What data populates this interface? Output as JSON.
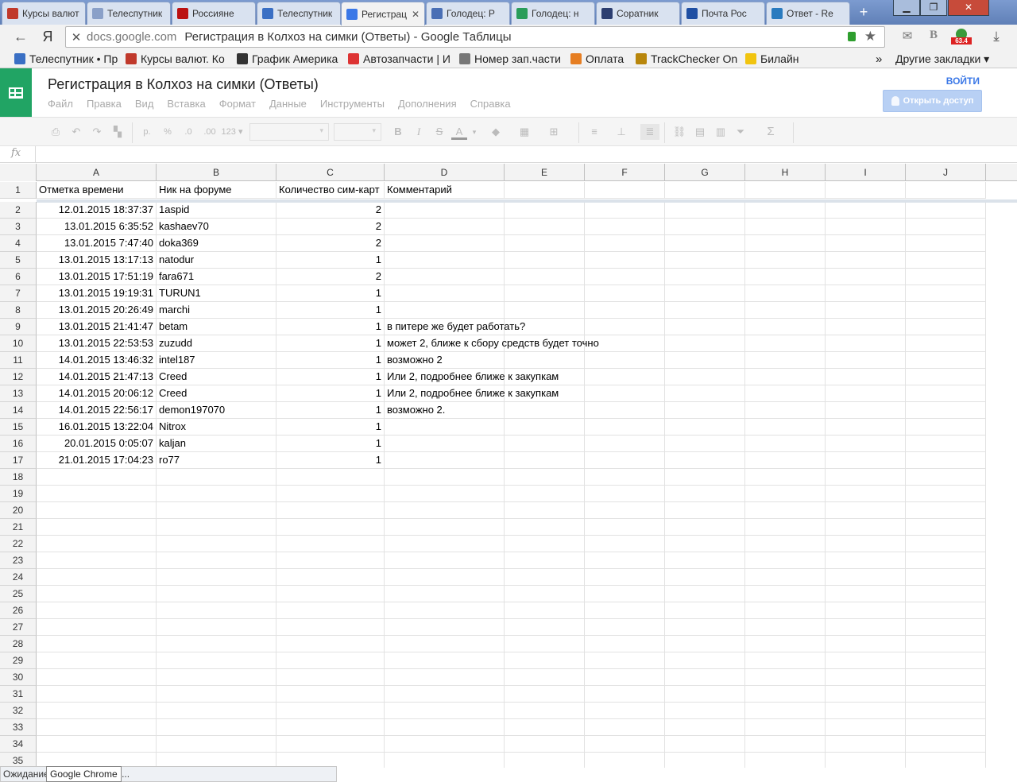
{
  "browser": {
    "tabs": [
      {
        "title": "Курсы валют",
        "color": "#c0392b",
        "icon": "bank-icon"
      },
      {
        "title": "Телеспутник",
        "color": "#8aa0c8",
        "icon": "loading-icon"
      },
      {
        "title": "Россияне",
        "color": "#b11",
        "icon": "v-icon"
      },
      {
        "title": "Телеспутник",
        "color": "#3a6fc4",
        "icon": "satellite-icon"
      },
      {
        "title": "Регистрация",
        "color": "#3b78e7",
        "icon": "loading-icon"
      },
      {
        "title": "Голодец: Р",
        "color": "#4a6fb5",
        "icon": "doc-icon"
      },
      {
        "title": "Голодец: н",
        "color": "#2a9d5a",
        "icon": "globe-icon"
      },
      {
        "title": "Соратник",
        "color": "#2c3e70",
        "icon": "moon-icon"
      },
      {
        "title": "Почта Рос",
        "color": "#1f4fa3",
        "icon": "eagle-icon"
      },
      {
        "title": "Ответ - Re",
        "color": "#2a7bbf",
        "icon": "chrome-icon"
      }
    ],
    "active_tab": 4,
    "new_tab": "+",
    "url_host": "docs.google.com",
    "url_title": "Регистрация в Колхоз на симки (Ответы) - Google Таблицы",
    "back": "←",
    "yandex": "Я",
    "stop": "✕",
    "star": "★",
    "download": "⤓",
    "badge": "63.4",
    "bookmarks": [
      {
        "label": "Телеспутник • Пр",
        "color": "#3a6fc4"
      },
      {
        "label": "Курсы валют. Ко",
        "color": "#c0392b"
      },
      {
        "label": "График Америка",
        "color": "#333"
      },
      {
        "label": "Автозапчасти | И",
        "color": "#d33"
      },
      {
        "label": "Номер зап.части",
        "color": "#777"
      },
      {
        "label": "Оплата",
        "color": "#e67e22"
      },
      {
        "label": "TrackChecker On",
        "color": "#b8860b"
      },
      {
        "label": "Билайн",
        "color": "#f1c40f"
      }
    ],
    "bookmarks_more": "»",
    "other_bookmarks": "Другие закладки ▾"
  },
  "docs": {
    "title": "Регистрация в Колхоз на симки (Ответы)",
    "menu": [
      "Файл",
      "Правка",
      "Вид",
      "Вставка",
      "Формат",
      "Данные",
      "Инструменты",
      "Дополнения",
      "Справка"
    ],
    "signin": "ВОЙТИ",
    "share": "Открыть доступ",
    "toolbar": {
      "currency": "р.",
      "percent": "%",
      "dec_less": ".0",
      "dec_more": ".00",
      "format": "123 ▾",
      "bold": "B",
      "italic": "I",
      "strike": "S",
      "textcolor": "A",
      "sigma": "Σ"
    },
    "fx": "fx"
  },
  "sheet": {
    "columns": [
      "A",
      "B",
      "C",
      "D",
      "E",
      "F",
      "G",
      "H",
      "I",
      "J"
    ],
    "header_row": [
      "Отметка времени",
      "Ник на форуме",
      "Количество сим-карт",
      "Комментарий"
    ],
    "rows": [
      [
        "12.01.2015 18:37:37",
        "1aspid",
        "2",
        ""
      ],
      [
        "13.01.2015 6:35:52",
        "kashaev70",
        "2",
        ""
      ],
      [
        "13.01.2015 7:47:40",
        "doka369",
        "2",
        ""
      ],
      [
        "13.01.2015 13:17:13",
        "natodur",
        "1",
        ""
      ],
      [
        "13.01.2015 17:51:19",
        "fara671",
        "2",
        ""
      ],
      [
        "13.01.2015 19:19:31",
        "TURUN1",
        "1",
        ""
      ],
      [
        "13.01.2015 20:26:49",
        "marchi",
        "1",
        ""
      ],
      [
        "13.01.2015 21:41:47",
        "betam",
        "1",
        "в питере же будет работать?"
      ],
      [
        "13.01.2015 22:53:53",
        "zuzudd",
        "1",
        "может 2, ближе к сбору средств будет точно"
      ],
      [
        "14.01.2015 13:46:32",
        "intel187",
        "1",
        "возможно 2"
      ],
      [
        "14.01.2015 21:47:13",
        "Creed",
        "1",
        "Или 2, подробнее ближе к закупкам"
      ],
      [
        "14.01.2015 20:06:12",
        "Creed",
        "1",
        "Или 2, подробнее ближе к закупкам"
      ],
      [
        "14.01.2015 22:56:17",
        "demon197070",
        "1",
        "возможно 2."
      ],
      [
        "16.01.2015 13:22:04",
        "Nitrox",
        "1",
        ""
      ],
      [
        "20.01.2015 0:05:07",
        "kaljan",
        "1",
        ""
      ],
      [
        "21.01.2015 17:04:23",
        "ro77",
        "1",
        ""
      ]
    ],
    "row_numbers_to": 35
  },
  "status": {
    "text": "Ожидание",
    "tooltip": "Google Chrome",
    "ellipsis": "..."
  }
}
